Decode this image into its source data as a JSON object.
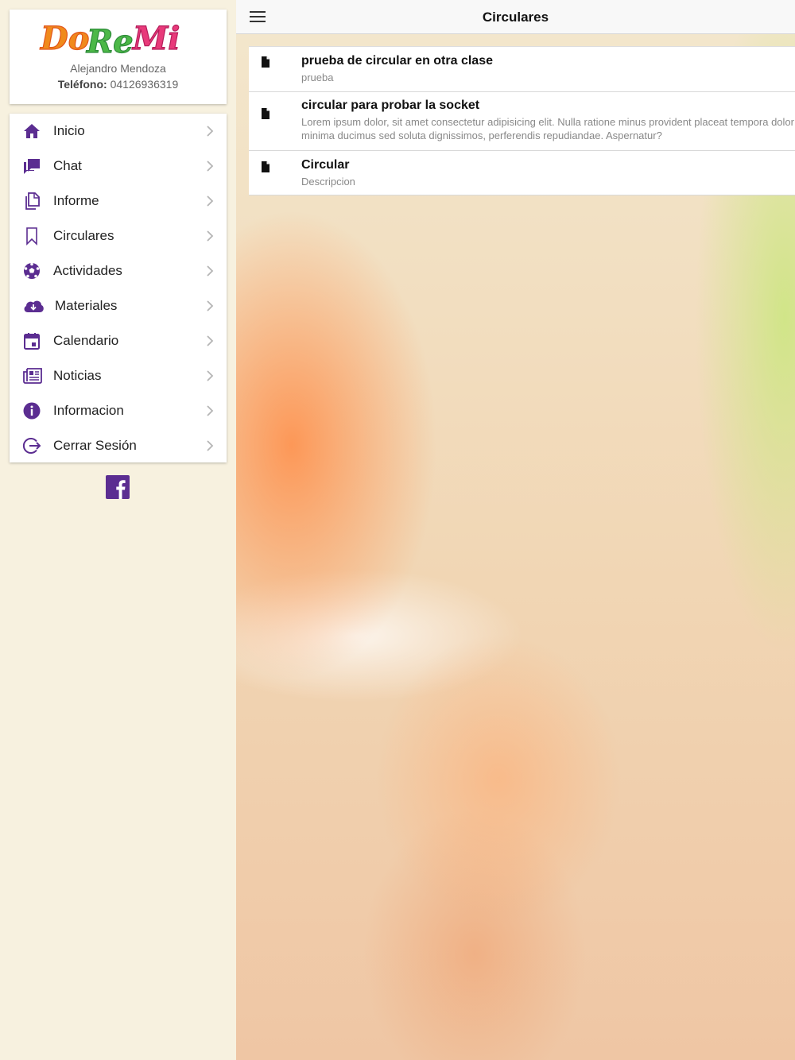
{
  "profile": {
    "logo_text": "DoReMi",
    "name": "Alejandro Mendoza",
    "phone_label": "Teléfono:",
    "phone_value": "04126936319"
  },
  "menu": {
    "items": [
      {
        "label": "Inicio",
        "icon": "home-icon"
      },
      {
        "label": "Chat",
        "icon": "chat-icon"
      },
      {
        "label": "Informe",
        "icon": "document-copy-icon"
      },
      {
        "label": "Circulares",
        "icon": "bookmark-icon"
      },
      {
        "label": "Actividades",
        "icon": "soccer-ball-icon"
      },
      {
        "label": "Materiales",
        "icon": "cloud-download-icon"
      },
      {
        "label": "Calendario",
        "icon": "calendar-icon"
      },
      {
        "label": "Noticias",
        "icon": "newspaper-icon"
      },
      {
        "label": "Informacion",
        "icon": "info-icon"
      },
      {
        "label": "Cerrar Sesión",
        "icon": "logout-icon"
      }
    ]
  },
  "social": {
    "icon": "facebook-icon"
  },
  "toolbar": {
    "title": "Circulares",
    "menu_icon": "hamburger-icon"
  },
  "circulars": [
    {
      "title": "prueba de circular en otra clase",
      "description": "prueba",
      "icon": "file-icon"
    },
    {
      "title": "circular para probar la socket",
      "description": "Lorem ipsum dolor, sit amet consectetur adipisicing elit. Nulla ratione minus provident placeat tempora dolor minima ducimus sed soluta dignissimos, perferendis repudiandae. Aspernatur?",
      "icon": "file-icon"
    },
    {
      "title": "Circular",
      "description": "Descripcion",
      "icon": "file-icon"
    }
  ],
  "colors": {
    "accent": "#5b2d91",
    "sidebar_bg": "#f7f1df",
    "chevron": "#b5b5b5"
  }
}
